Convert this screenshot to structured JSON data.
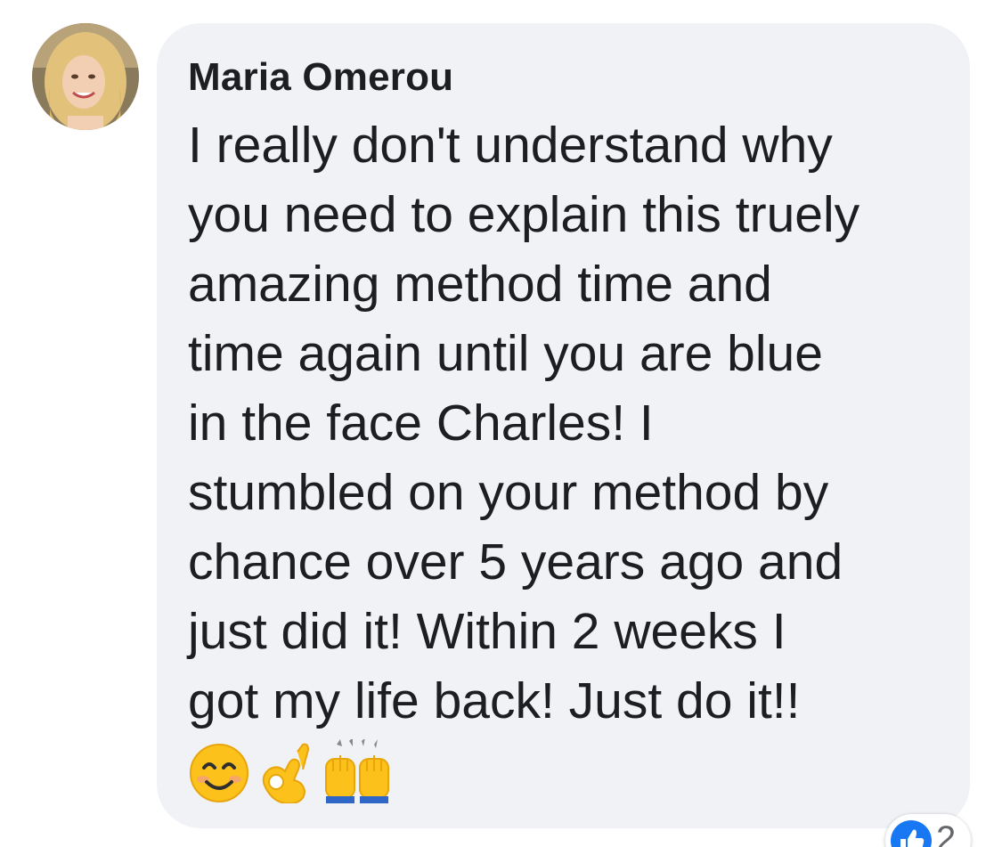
{
  "comment": {
    "author": "Maria Omerou",
    "text": "I really don't understand why\nyou need to explain this truely\namazing method time and\ntime again until you are blue\nin the face Charles! I\nstumbled on your method by\nchance over 5 years ago and\njust did it! Within 2 weeks I\ngot my life back! Just do it!!",
    "emojis": [
      "smiling-face-icon",
      "ok-hand-icon",
      "raising-hands-icon"
    ]
  },
  "reactions": {
    "icon": "like-icon",
    "count": "2"
  },
  "colors": {
    "bubble": "#f0f2f5",
    "text": "#1c1e21",
    "like": "#1877f2"
  }
}
